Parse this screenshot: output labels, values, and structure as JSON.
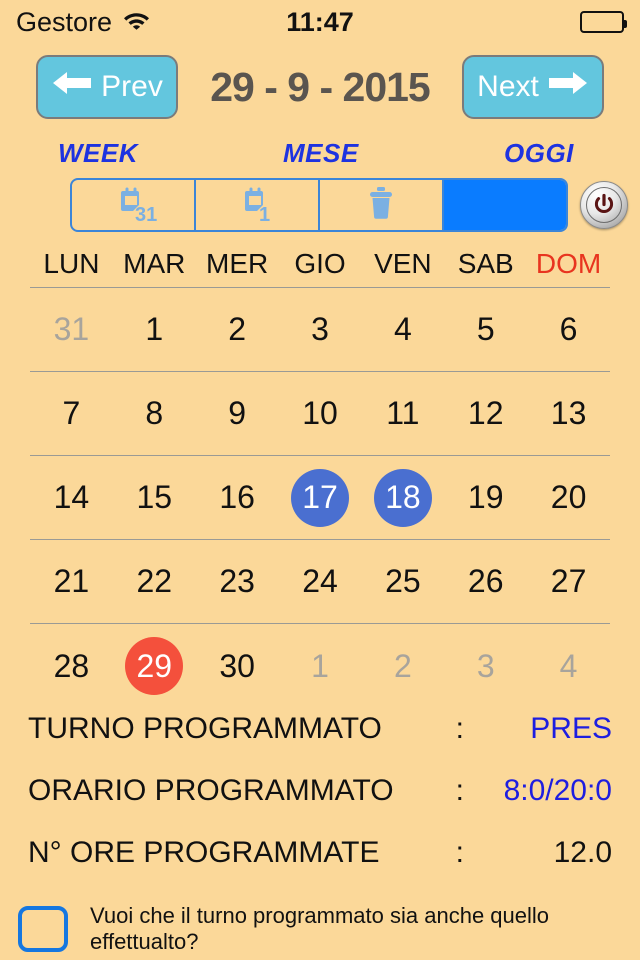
{
  "theme": {
    "background": "#fbd899",
    "accent_blue": "#1e33e0",
    "button_cyan": "#63c6de",
    "segment_blue": "#0a7cff",
    "selected_day": "#4a6fd0",
    "today": "#f4503c",
    "sunday": "#e8341f"
  },
  "status_bar": {
    "carrier": "Gestore",
    "wifi_icon": "wifi-icon",
    "time": "11:47",
    "battery_icon": "battery-full-icon"
  },
  "nav": {
    "prev_label": "Prev",
    "prev_icon": "arrow-left-icon",
    "next_label": "Next",
    "next_icon": "arrow-right-icon",
    "date_title": "29 - 9 - 2015"
  },
  "segment_labels": {
    "week": "WEEK",
    "mese": "MESE",
    "oggi": "OGGI"
  },
  "segments": [
    {
      "icon": "calendar-31-icon",
      "badge": "31",
      "selected": false
    },
    {
      "icon": "calendar-1-icon",
      "badge": "1",
      "selected": false
    },
    {
      "icon": "trash-icon",
      "badge": "",
      "selected": false
    },
    {
      "icon": "",
      "badge": "",
      "selected": true
    }
  ],
  "power_button": {
    "icon": "power-icon"
  },
  "calendar": {
    "weekday_headers": [
      "LUN",
      "MAR",
      "MER",
      "GIO",
      "VEN",
      "SAB",
      "DOM"
    ],
    "weeks": [
      [
        {
          "day": "31",
          "state": "muted"
        },
        {
          "day": "1",
          "state": "normal"
        },
        {
          "day": "2",
          "state": "normal"
        },
        {
          "day": "3",
          "state": "normal"
        },
        {
          "day": "4",
          "state": "normal"
        },
        {
          "day": "5",
          "state": "normal"
        },
        {
          "day": "6",
          "state": "normal"
        }
      ],
      [
        {
          "day": "7",
          "state": "normal"
        },
        {
          "day": "8",
          "state": "normal"
        },
        {
          "day": "9",
          "state": "normal"
        },
        {
          "day": "10",
          "state": "normal"
        },
        {
          "day": "11",
          "state": "normal"
        },
        {
          "day": "12",
          "state": "normal"
        },
        {
          "day": "13",
          "state": "normal"
        }
      ],
      [
        {
          "day": "14",
          "state": "normal"
        },
        {
          "day": "15",
          "state": "normal"
        },
        {
          "day": "16",
          "state": "normal"
        },
        {
          "day": "17",
          "state": "selected"
        },
        {
          "day": "18",
          "state": "selected"
        },
        {
          "day": "19",
          "state": "normal"
        },
        {
          "day": "20",
          "state": "normal"
        }
      ],
      [
        {
          "day": "21",
          "state": "normal"
        },
        {
          "day": "22",
          "state": "normal"
        },
        {
          "day": "23",
          "state": "normal"
        },
        {
          "day": "24",
          "state": "normal"
        },
        {
          "day": "25",
          "state": "normal"
        },
        {
          "day": "26",
          "state": "normal"
        },
        {
          "day": "27",
          "state": "normal"
        }
      ],
      [
        {
          "day": "28",
          "state": "normal"
        },
        {
          "day": "29",
          "state": "today"
        },
        {
          "day": "30",
          "state": "normal"
        },
        {
          "day": "1",
          "state": "muted"
        },
        {
          "day": "2",
          "state": "muted"
        },
        {
          "day": "3",
          "state": "muted"
        },
        {
          "day": "4",
          "state": "muted"
        }
      ]
    ]
  },
  "info_rows": [
    {
      "label": "TURNO PROGRAMMATO",
      "separator": ":",
      "value": "PRES",
      "value_color": "blue"
    },
    {
      "label": "ORARIO PROGRAMMATO",
      "separator": ":",
      "value": "8:0/20:0",
      "value_color": "blue"
    },
    {
      "label": "N° ORE PROGRAMMATE",
      "separator": ":",
      "value": "12.0",
      "value_color": "black"
    }
  ],
  "bottom": {
    "checkbox_checked": false,
    "question": "Vuoi che il turno programmato sia anche quello effettualto?"
  }
}
